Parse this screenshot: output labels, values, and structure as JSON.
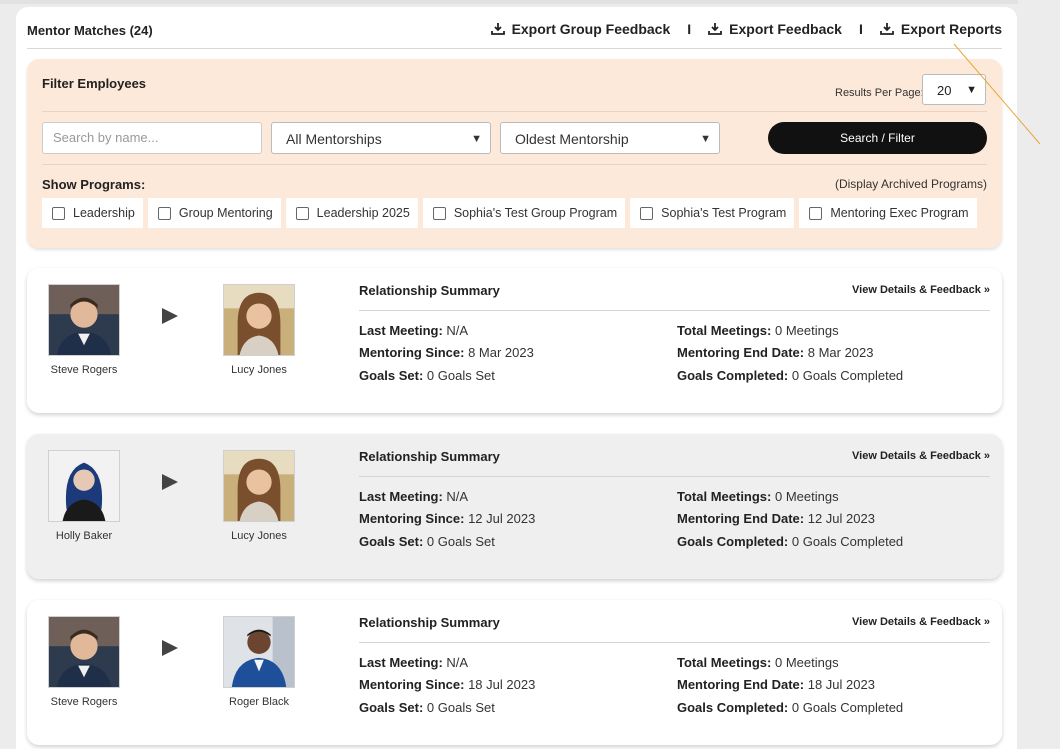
{
  "header": {
    "title": "Mentor Matches (24)",
    "exports": [
      {
        "label": "Export Group Feedback",
        "icon": "download-icon"
      },
      {
        "label": "Export Feedback",
        "icon": "download-icon"
      },
      {
        "label": "Export Reports",
        "icon": "download-icon"
      }
    ],
    "separator": "I"
  },
  "filter": {
    "title": "Filter Employees",
    "results_per_page_label": "Results Per Page:",
    "results_per_page_value": "20",
    "search_placeholder": "Search by name...",
    "mentorship_select": "All Mentorships",
    "sort_select": "Oldest Mentorship",
    "search_button": "Search / Filter",
    "show_programs_label": "Show Programs:",
    "archived_link": "(Display Archived Programs)",
    "programs": [
      "Leadership",
      "Group Mentoring",
      "Leadership 2025",
      "Sophia's Test Group Program",
      "Sophia's Test Program",
      "Mentoring Exec Program"
    ]
  },
  "labels": {
    "summary_title": "Relationship Summary",
    "view_details": "View Details & Feedback »",
    "last_meeting": "Last Meeting:",
    "mentoring_since": "Mentoring Since:",
    "goals_set": "Goals Set:",
    "total_meetings": "Total Meetings:",
    "end_date": "Mentoring End Date:",
    "goals_completed": "Goals Completed:"
  },
  "matches": [
    {
      "mentor": "Steve Rogers",
      "mentee": "Lucy Jones",
      "last_meeting": "N/A",
      "mentoring_since": "8 Mar 2023",
      "goals_set": "0 Goals Set",
      "total_meetings": "0 Meetings",
      "end_date": "8 Mar 2023",
      "goals_completed": "0 Goals Completed"
    },
    {
      "mentor": "Holly Baker",
      "mentee": "Lucy Jones",
      "last_meeting": "N/A",
      "mentoring_since": "12 Jul 2023",
      "goals_set": "0 Goals Set",
      "total_meetings": "0 Meetings",
      "end_date": "12 Jul 2023",
      "goals_completed": "0 Goals Completed"
    },
    {
      "mentor": "Steve Rogers",
      "mentee": "Roger Black",
      "last_meeting": "N/A",
      "mentoring_since": "18 Jul 2023",
      "goals_set": "0 Goals Set",
      "total_meetings": "0 Meetings",
      "end_date": "18 Jul 2023",
      "goals_completed": "0 Goals Completed"
    }
  ]
}
